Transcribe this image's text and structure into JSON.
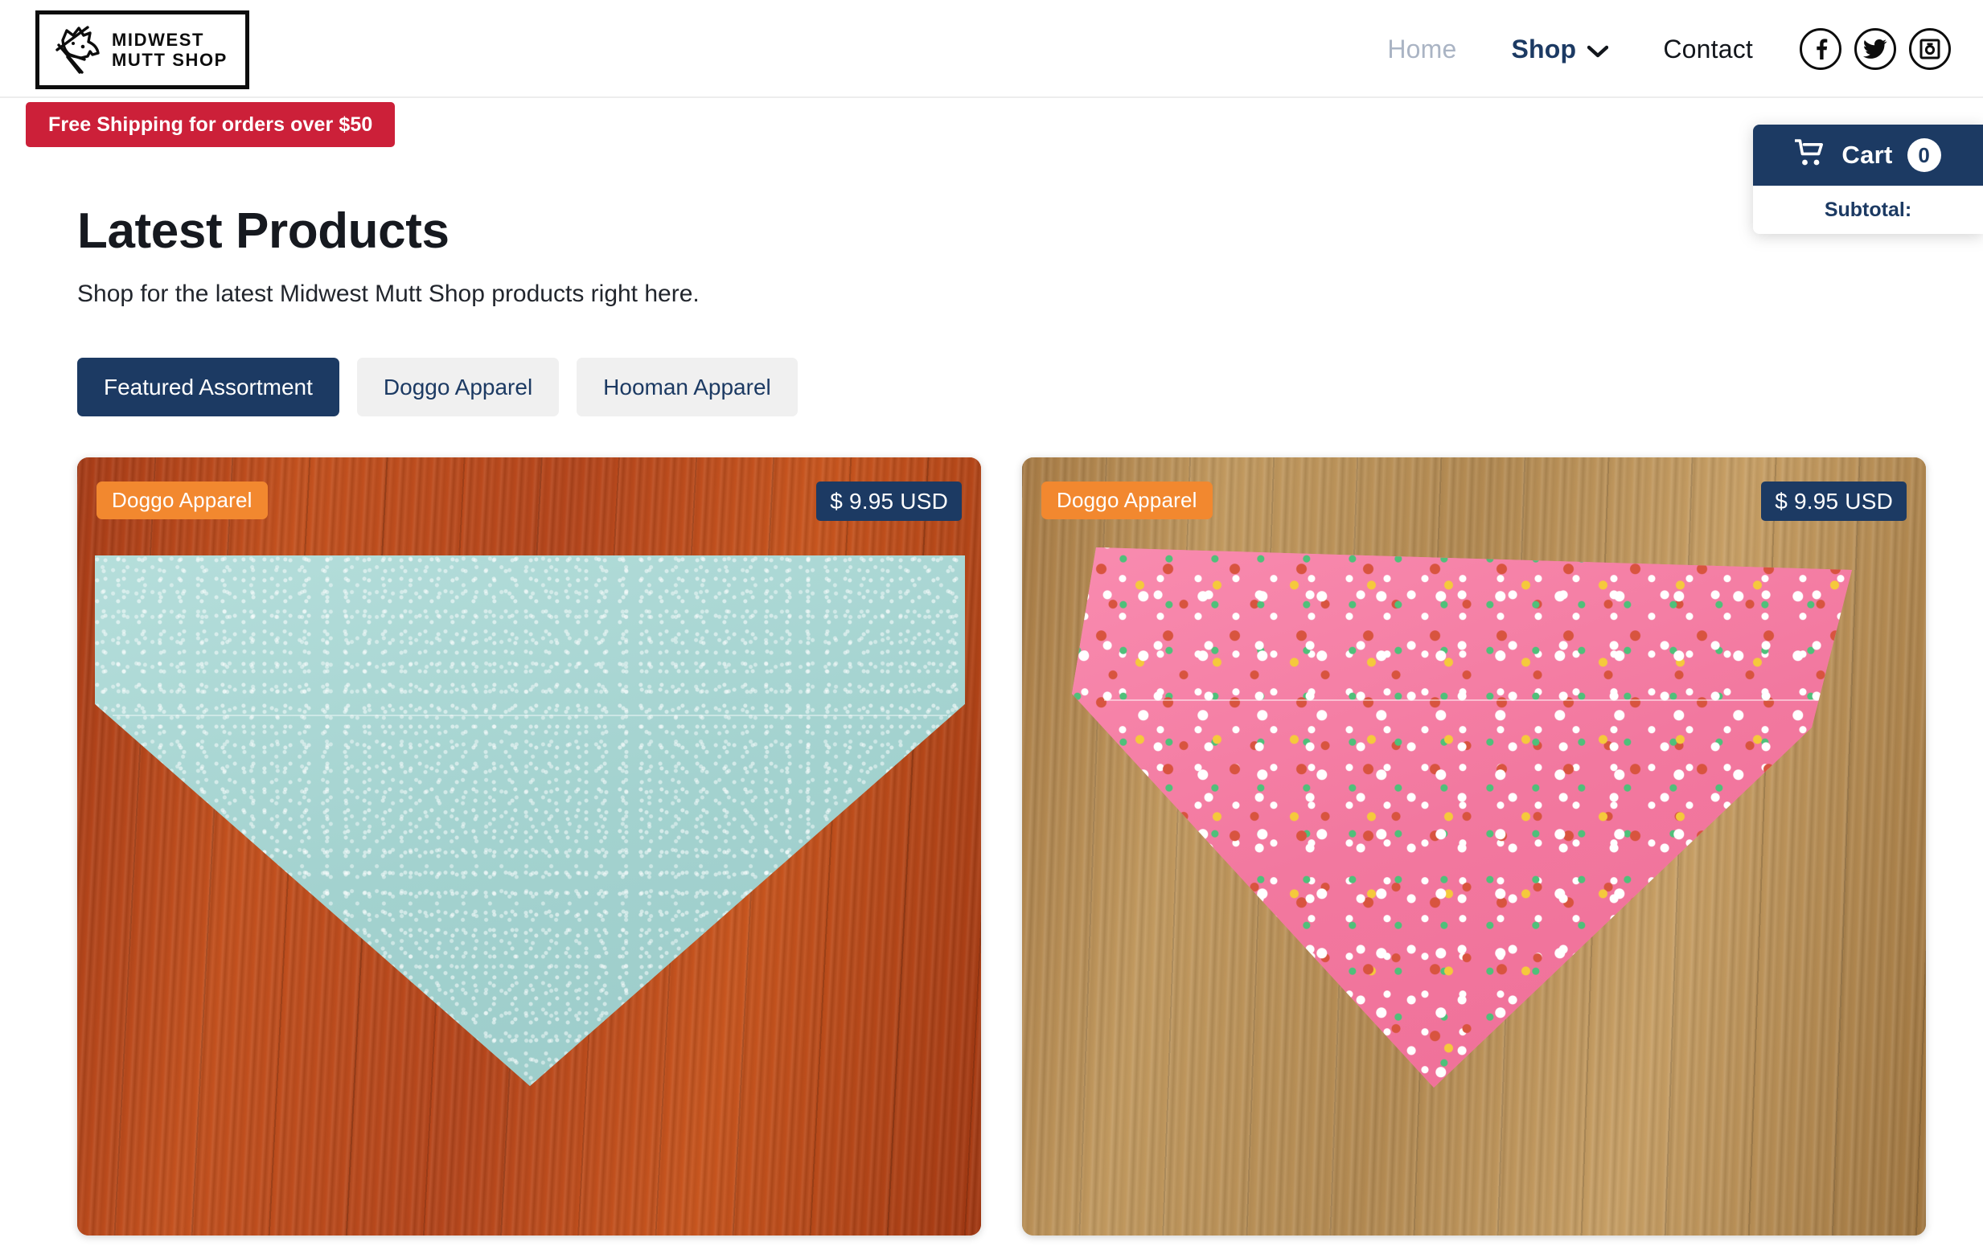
{
  "header": {
    "logo": {
      "icon": "dog-head-logo-icon",
      "line1": "MIDWEST",
      "line2": "MUTT SHOP"
    },
    "nav": [
      {
        "label": "Home",
        "name": "nav-link-home",
        "state": "muted"
      },
      {
        "label": "Shop",
        "name": "nav-link-shop",
        "state": "active",
        "has_dropdown": true
      },
      {
        "label": "Contact",
        "name": "nav-link-contact",
        "state": "default"
      }
    ],
    "social": [
      {
        "label": "Facebook",
        "icon": "facebook-icon"
      },
      {
        "label": "Twitter",
        "icon": "twitter-icon"
      },
      {
        "label": "Instagram",
        "icon": "instagram-icon"
      }
    ]
  },
  "shipping_banner": {
    "text": "Free Shipping for orders over $50",
    "color": "#cc2039"
  },
  "cart": {
    "icon": "shopping-cart-icon",
    "label": "Cart",
    "count": "0",
    "subtotal_label": "Subtotal:",
    "subtotal_value": "",
    "color": "#1c3a63"
  },
  "main": {
    "title": "Latest Products",
    "subtitle": "Shop for the latest Midwest Mutt Shop products right here.",
    "tabs": [
      {
        "label": "Featured Assortment",
        "active": true
      },
      {
        "label": "Doggo Apparel",
        "active": false
      },
      {
        "label": "Hooman Apparel",
        "active": false
      }
    ],
    "products": [
      {
        "category": "Doggo Apparel",
        "price": "$ 9.95 USD",
        "image_alt": "teal-bandana-on-red-oak-floor"
      },
      {
        "category": "Doggo Apparel",
        "price": "$ 9.95 USD",
        "image_alt": "pink-floral-bandana-on-oak-floor"
      }
    ]
  },
  "colors": {
    "navy": "#1c3a63",
    "orange": "#f2882f",
    "crimson": "#cc2039",
    "muted": "#aab4c4"
  }
}
